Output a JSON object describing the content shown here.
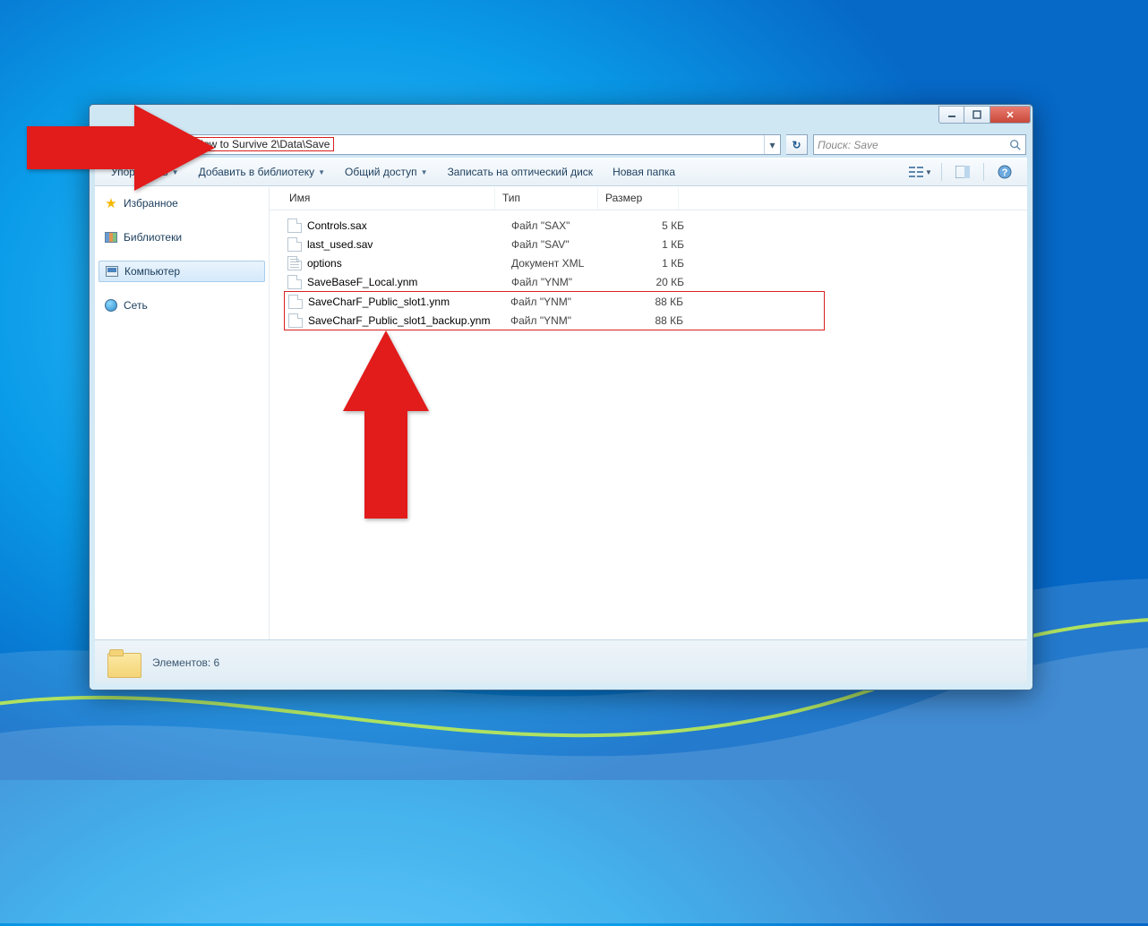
{
  "address": {
    "path_display": "s\\How to Survive 2\\Data\\Save"
  },
  "search": {
    "placeholder": "Поиск: Save"
  },
  "toolbar": {
    "organize": "Упор…чить",
    "addlib": "Добавить в библиотеку",
    "share": "Общий доступ",
    "burn": "Записать на оптический диск",
    "newfolder": "Новая папка"
  },
  "sidebar": {
    "favorites": "Избранное",
    "libraries": "Библиотеки",
    "computer": "Компьютер",
    "network": "Сеть"
  },
  "columns": {
    "name": "Имя",
    "type": "Тип",
    "size": "Размер"
  },
  "files": [
    {
      "name": "Controls.sax",
      "type": "Файл \"SAX\"",
      "size": "5 КБ",
      "icon": "file"
    },
    {
      "name": "last_used.sav",
      "type": "Файл \"SAV\"",
      "size": "1 КБ",
      "icon": "file"
    },
    {
      "name": "options",
      "type": "Документ XML",
      "size": "1 КБ",
      "icon": "xml"
    },
    {
      "name": "SaveBaseF_Local.ynm",
      "type": "Файл \"YNM\"",
      "size": "20 КБ",
      "icon": "file"
    }
  ],
  "files_highlighted": [
    {
      "name": "SaveCharF_Public_slot1.ynm",
      "type": "Файл \"YNM\"",
      "size": "88 КБ",
      "icon": "file"
    },
    {
      "name": "SaveCharF_Public_slot1_backup.ynm",
      "type": "Файл \"YNM\"",
      "size": "88 КБ",
      "icon": "file"
    }
  ],
  "status": {
    "text": "Элементов: 6"
  }
}
